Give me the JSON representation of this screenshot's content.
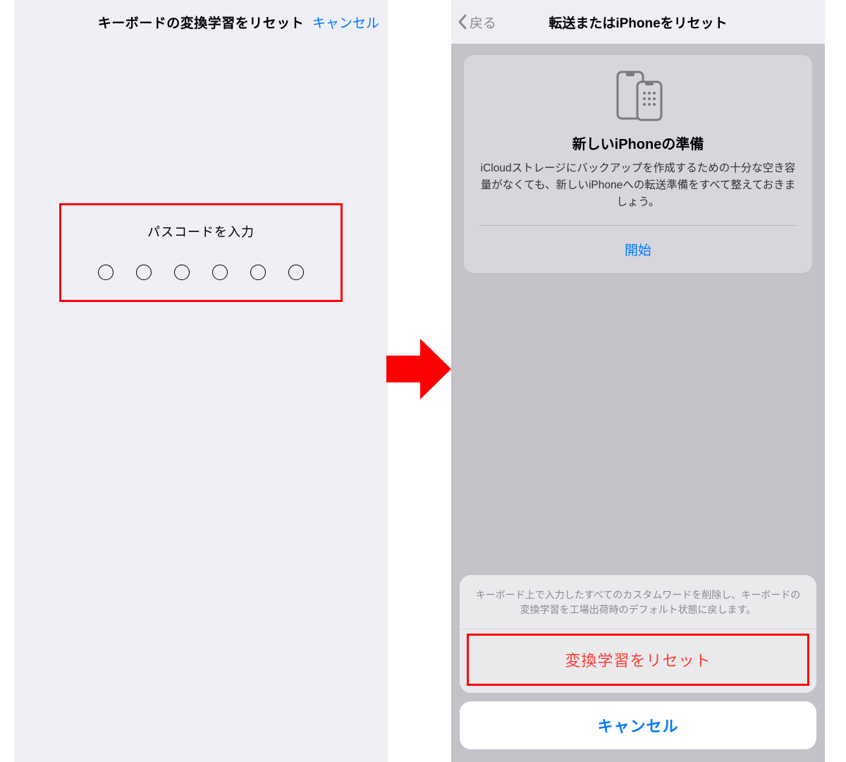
{
  "left": {
    "title": "キーボードの変換学習をリセット",
    "cancel": "キャンセル",
    "passcode_label": "パスコードを入力",
    "passcode_digits": 6
  },
  "right": {
    "back": "戻る",
    "title": "転送またはiPhoneをリセット",
    "panel": {
      "heading": "新しいiPhoneの準備",
      "description": "iCloudストレージにバックアップを作成するための十分な空き容量がなくても、新しいiPhoneへの転送準備をすべて整えておきましょう。",
      "start": "開始"
    },
    "sheet": {
      "message": "キーボード上で入力したすべてのカスタムワードを削除し、キーボードの変換学習を工場出荷時のデフォルト状態に戻します。",
      "destructive": "変換学習をリセット",
      "cancel": "キャンセル"
    }
  }
}
